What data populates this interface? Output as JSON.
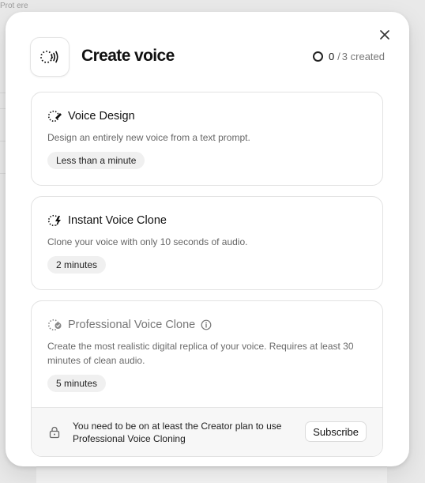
{
  "backdrop": {
    "top_text": "Prot ere"
  },
  "modal": {
    "title": "Create voice",
    "counter": {
      "current": "0",
      "separator": "/",
      "total_label": "3 created"
    }
  },
  "cards": [
    {
      "title": "Voice Design",
      "description": "Design an entirely new voice from a text prompt.",
      "duration": "Less than a minute",
      "icon": "voice-design-icon"
    },
    {
      "title": "Instant Voice Clone",
      "description": "Clone your voice with only 10 seconds of audio.",
      "duration": "2 minutes",
      "icon": "instant-clone-icon"
    },
    {
      "title": "Professional Voice Clone",
      "description": "Create the most realistic digital replica of your voice. Requires at least 30 minutes of clean audio.",
      "duration": "5 minutes",
      "icon": "professional-clone-icon",
      "notice": "You need to be on at least the Creator plan to use Professional Voice Cloning",
      "action": "Subscribe"
    }
  ]
}
